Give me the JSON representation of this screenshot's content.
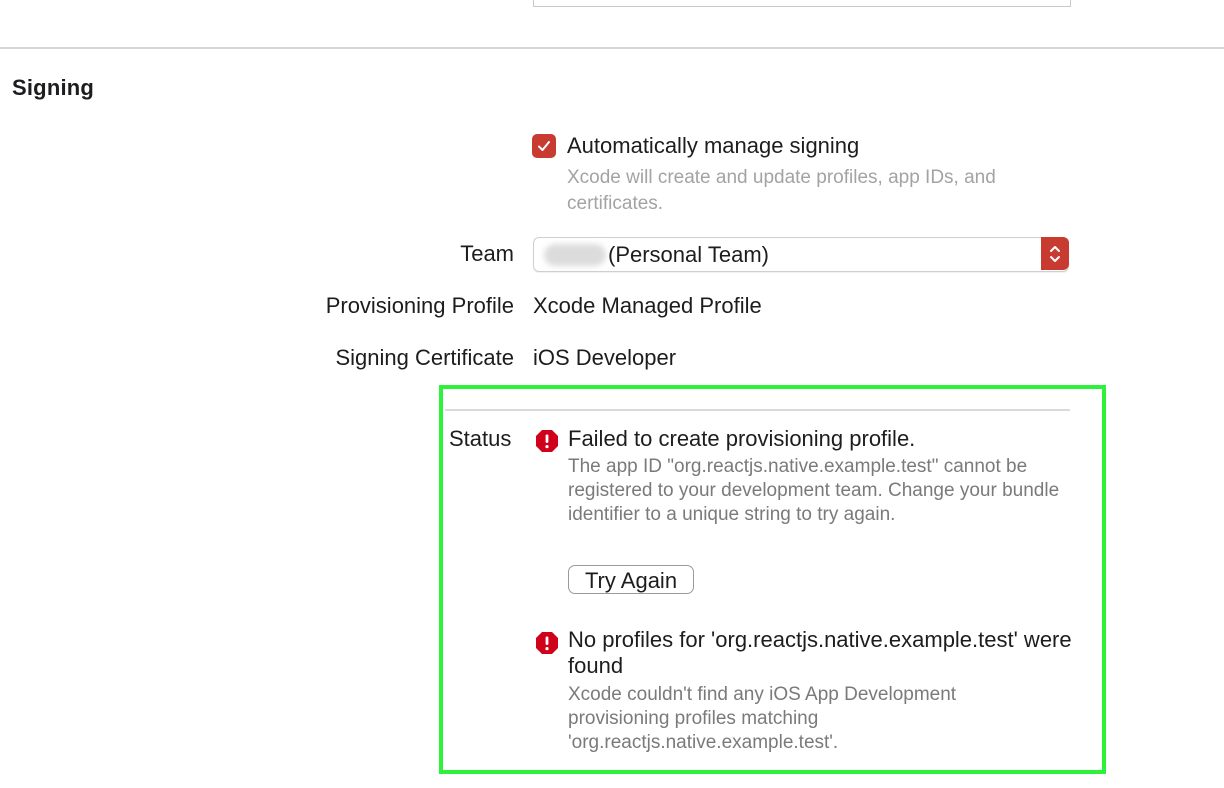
{
  "section": {
    "title": "Signing"
  },
  "auto_signing": {
    "checked": true,
    "label": "Automatically manage signing",
    "description": "Xcode will create and update profiles, app IDs, and certificates."
  },
  "team": {
    "label": "Team",
    "value": "(Personal Team)"
  },
  "provisioning_profile": {
    "label": "Provisioning Profile",
    "value": "Xcode Managed Profile"
  },
  "signing_certificate": {
    "label": "Signing Certificate",
    "value": "iOS Developer"
  },
  "status": {
    "label": "Status",
    "messages": [
      {
        "icon": "error-icon",
        "title": "Failed to create provisioning profile.",
        "description": "The app ID \"org.reactjs.native.example.test\" cannot be registered to your development team. Change your bundle identifier to a unique string to try again.",
        "action": "Try Again"
      },
      {
        "icon": "error-icon",
        "title": "No profiles for 'org.reactjs.native.example.test' were found",
        "description": "Xcode couldn't find any iOS App Development provisioning profiles matching 'org.reactjs.native.example.test'."
      }
    ]
  },
  "colors": {
    "accent": "#c73b30",
    "error": "#d0021b",
    "highlight": "#2cf23a"
  }
}
